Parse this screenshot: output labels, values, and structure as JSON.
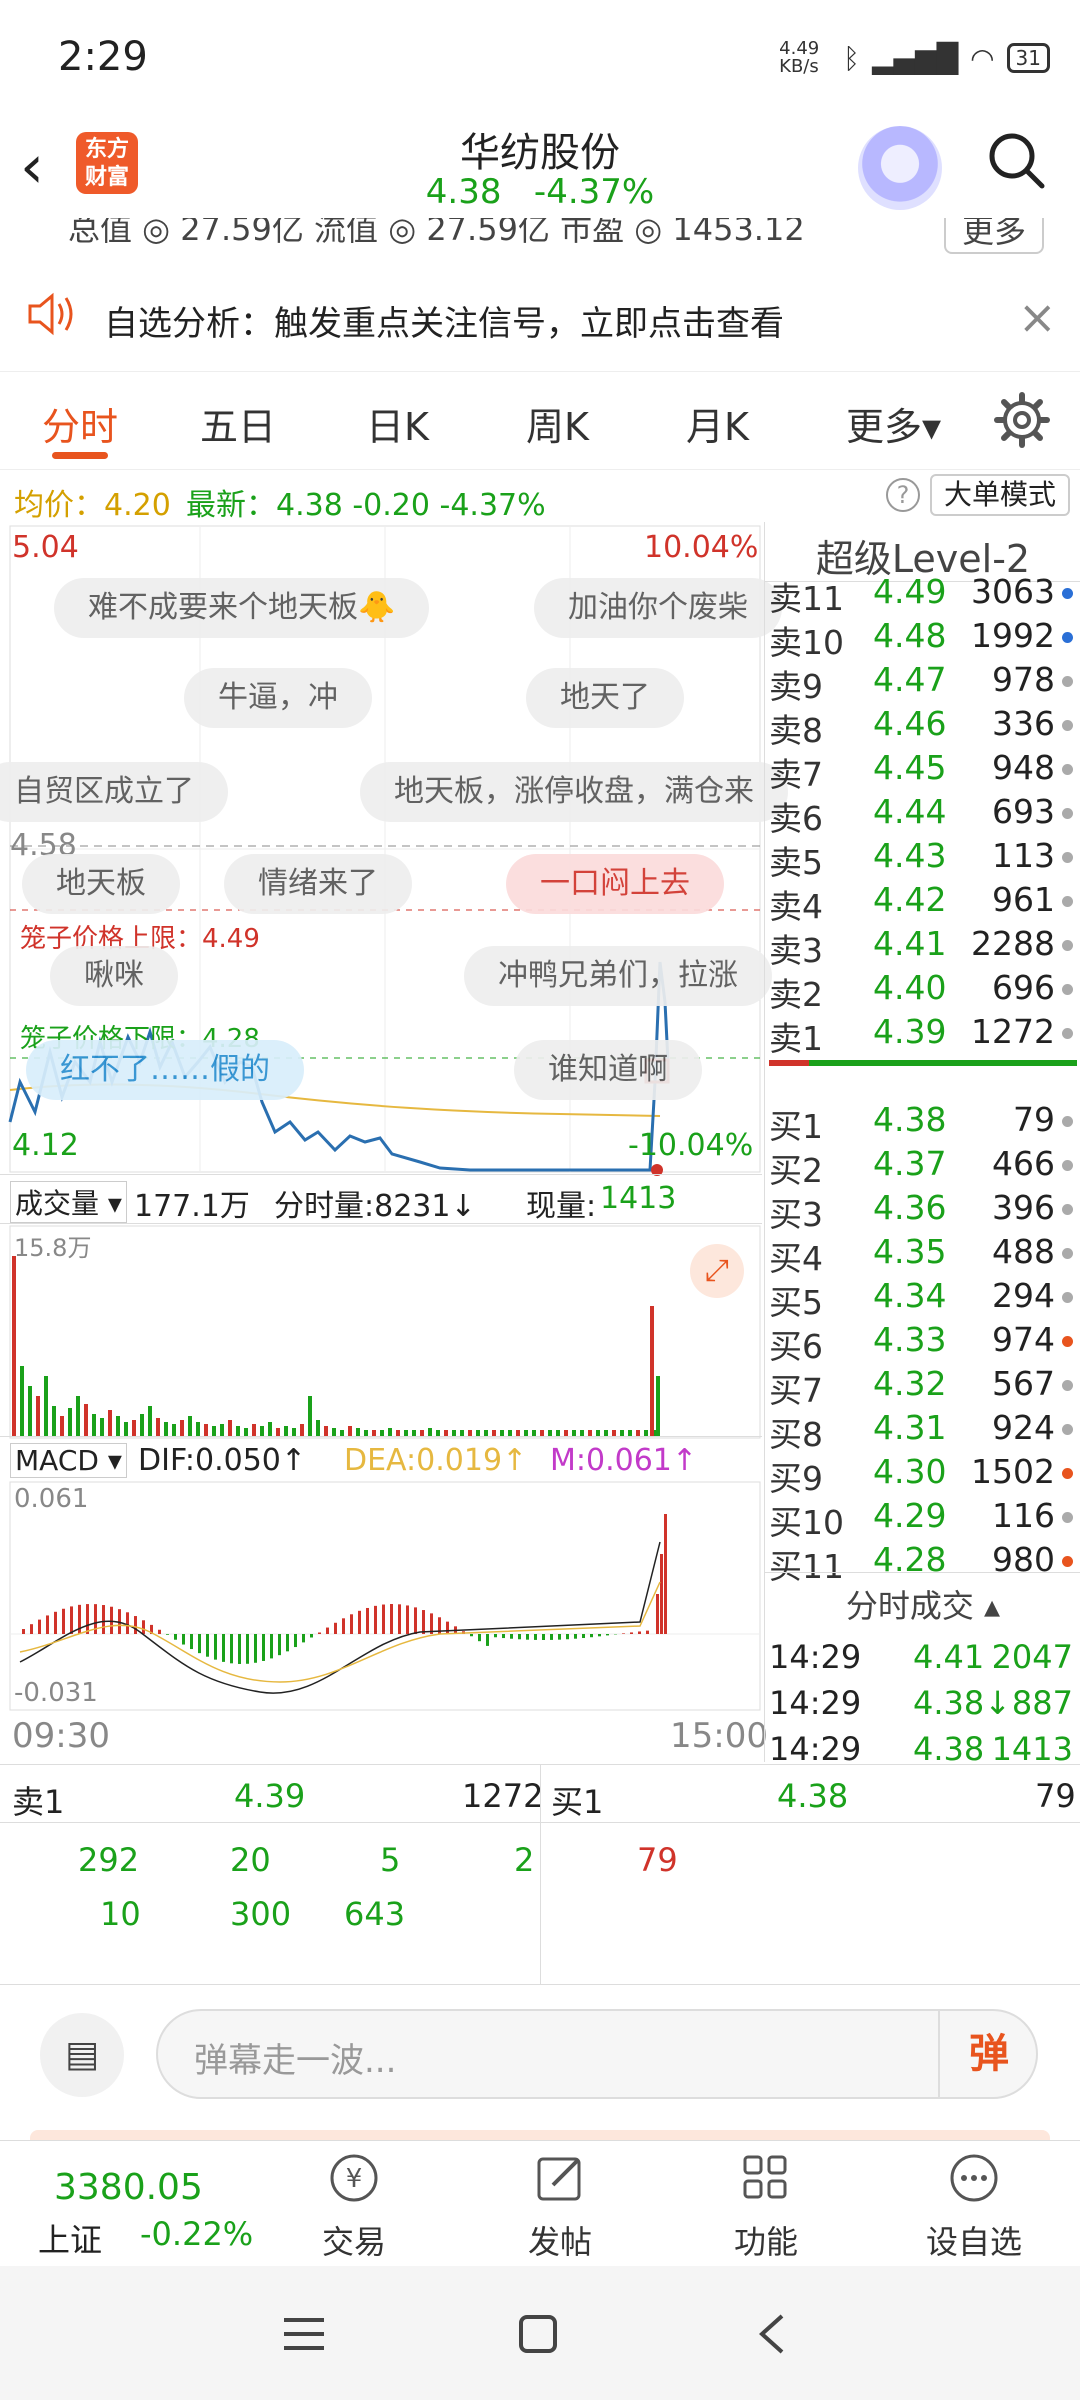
{
  "status": {
    "time": "2:29",
    "net_speed": "4.49 KB/s",
    "battery": "31"
  },
  "header": {
    "logo_text": "东方财富",
    "title": "华纺股份",
    "price": "4.38",
    "change_pct": "-4.37%"
  },
  "partial_stats": {
    "text": "总值 ◎ 27.59亿   流值 ◎ 27.59亿   市盈 ◎ 1453.12",
    "more": "更多"
  },
  "notice": {
    "text": "自选分析：触发重点关注信号，立即点击查看",
    "close": "×"
  },
  "tabs": [
    {
      "label": "分时"
    },
    {
      "label": "五日"
    },
    {
      "label": "日K"
    },
    {
      "label": "周K"
    },
    {
      "label": "月K"
    },
    {
      "label": "更多▾"
    }
  ],
  "infobar": {
    "avg": "均价：4.20",
    "newest": "最新：4.38  -0.20  -4.37%",
    "help": "?",
    "big_mode": "大单模式"
  },
  "price_chart": {
    "top_left": "5.04",
    "top_right": "10.04%",
    "line_label": "4.58",
    "cage_upper": "笼子价格上限：4.49",
    "cage_lower": "笼子价格下限：4.28",
    "bottom_left": "4.12",
    "bottom_right": "-10.04%"
  },
  "danmu": [
    {
      "text": "难不成要来个地天板🐥"
    },
    {
      "text": "加油你个废柴"
    },
    {
      "text": "牛逼，冲"
    },
    {
      "text": "地天了"
    },
    {
      "text": "自贸区成立了"
    },
    {
      "text": "地天板，涨停收盘，满仓来"
    },
    {
      "text": "地天板"
    },
    {
      "text": "情绪来了"
    },
    {
      "text": "一口闷上去"
    },
    {
      "text": "啾咪"
    },
    {
      "text": "冲鸭兄弟们，拉涨"
    },
    {
      "text": "红不了……假的"
    },
    {
      "text": "谁知道啊"
    }
  ],
  "volume": {
    "label": "成交量 ▾",
    "total": "177.1万",
    "tick_vol": "分时量:8231↓",
    "now_label": "现量:",
    "now_val": "1413",
    "max_label": "15.8万"
  },
  "macd": {
    "label": "MACD ▾",
    "dif": "DIF:0.050↑",
    "dea": "DEA:0.019↑",
    "m": "M:0.061↑",
    "top": "0.061",
    "bottom": "-0.031"
  },
  "time_axis": {
    "start": "09:30",
    "end": "15:00"
  },
  "level2": {
    "title": "超级Level-2",
    "asks": [
      {
        "name": "卖11",
        "price": "4.49",
        "vol": "3063",
        "dot": "#2a6fd6"
      },
      {
        "name": "卖10",
        "price": "4.48",
        "vol": "1992",
        "dot": "#2a6fd6"
      },
      {
        "name": "卖9",
        "price": "4.47",
        "vol": "978",
        "dot": "#aaaaaa"
      },
      {
        "name": "卖8",
        "price": "4.46",
        "vol": "336",
        "dot": "#aaaaaa"
      },
      {
        "name": "卖7",
        "price": "4.45",
        "vol": "948",
        "dot": "#aaaaaa"
      },
      {
        "name": "卖6",
        "price": "4.44",
        "vol": "693",
        "dot": "#aaaaaa"
      },
      {
        "name": "卖5",
        "price": "4.43",
        "vol": "113",
        "dot": "#aaaaaa"
      },
      {
        "name": "卖4",
        "price": "4.42",
        "vol": "961",
        "dot": "#aaaaaa"
      },
      {
        "name": "卖3",
        "price": "4.41",
        "vol": "2288",
        "dot": "#aaaaaa"
      },
      {
        "name": "卖2",
        "price": "4.40",
        "vol": "696",
        "dot": "#aaaaaa"
      },
      {
        "name": "卖1",
        "price": "4.39",
        "vol": "1272",
        "dot": "#aaaaaa"
      }
    ],
    "bids": [
      {
        "name": "买1",
        "price": "4.38",
        "vol": "79",
        "dot": "#aaaaaa"
      },
      {
        "name": "买2",
        "price": "4.37",
        "vol": "466",
        "dot": "#aaaaaa"
      },
      {
        "name": "买3",
        "price": "4.36",
        "vol": "396",
        "dot": "#aaaaaa"
      },
      {
        "name": "买4",
        "price": "4.35",
        "vol": "488",
        "dot": "#aaaaaa"
      },
      {
        "name": "买5",
        "price": "4.34",
        "vol": "294",
        "dot": "#aaaaaa"
      },
      {
        "name": "买6",
        "price": "4.33",
        "vol": "974",
        "dot": "#e8541e"
      },
      {
        "name": "买7",
        "price": "4.32",
        "vol": "567",
        "dot": "#aaaaaa"
      },
      {
        "name": "买8",
        "price": "4.31",
        "vol": "924",
        "dot": "#aaaaaa"
      },
      {
        "name": "买9",
        "price": "4.30",
        "vol": "1502",
        "dot": "#e8541e"
      },
      {
        "name": "买10",
        "price": "4.29",
        "vol": "116",
        "dot": "#aaaaaa"
      },
      {
        "name": "买11",
        "price": "4.28",
        "vol": "980",
        "dot": "#e8541e"
      }
    ],
    "ticks_title": "分时成交 ▴",
    "ticks": [
      {
        "time": "14:29",
        "price": "4.41",
        "vol": "2047"
      },
      {
        "time": "14:29",
        "price": "4.38↓",
        "vol": "887"
      },
      {
        "time": "14:29",
        "price": "4.38",
        "vol": "1413"
      }
    ]
  },
  "queue": {
    "sell_label": "卖1",
    "sell_price": "4.39",
    "sell_vol": "1272",
    "buy_label": "买1",
    "buy_price": "4.38",
    "buy_vol": "79",
    "sell_orders_row1": [
      "292",
      "20",
      "5",
      "2"
    ],
    "sell_orders_row2": [
      "10",
      "300",
      "643"
    ],
    "buy_orders_row1": [
      "79"
    ]
  },
  "comment": {
    "placeholder": "弹幕走一波...",
    "danmu_btn": "弹"
  },
  "bottom_nav": {
    "index_value": "3380.05",
    "index_name": "上证",
    "index_change": "-0.22%",
    "items": [
      {
        "label": "交易"
      },
      {
        "label": "发帖"
      },
      {
        "label": "功能"
      },
      {
        "label": "设自选"
      }
    ]
  },
  "colors": {
    "accent": "#e8541e",
    "up": "#d0332a",
    "down": "#1aa11a",
    "price_line": "#2a6fb0",
    "avg_line": "#e6b840"
  }
}
